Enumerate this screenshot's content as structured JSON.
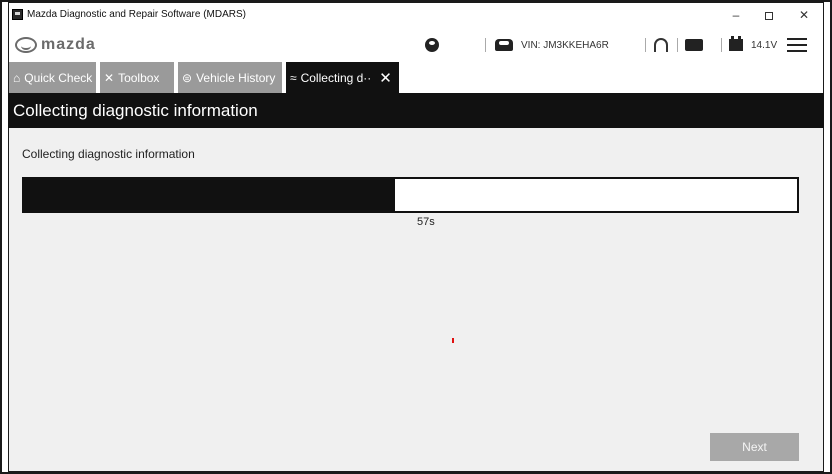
{
  "window": {
    "title": "Mazda Diagnostic and Repair Software (MDARS)",
    "minimize": "–",
    "close": "✕"
  },
  "header": {
    "logo_text": "mazda",
    "vin": "VIN: JM3KKEHA6R",
    "voltage": "14.1V"
  },
  "tabs": [
    {
      "label": "Quick Check",
      "icon": "car-check-icon"
    },
    {
      "label": "Toolbox",
      "icon": "tools-icon"
    },
    {
      "label": "Vehicle History",
      "icon": "history-icon"
    },
    {
      "label": "Collecting d··",
      "icon": "collect-icon",
      "active": true,
      "close": "✕"
    }
  ],
  "page": {
    "title": "Collecting diagnostic information",
    "subtitle": "Collecting diagnostic information"
  },
  "progress": {
    "fraction": 0.48,
    "time_label": "57s"
  },
  "footer": {
    "next_label": "Next"
  },
  "colors": {
    "accent_dark": "#111111",
    "tab_inactive": "#9a9a9a",
    "button_disabled": "#a8a8a8",
    "marker_red": "#e01010"
  }
}
